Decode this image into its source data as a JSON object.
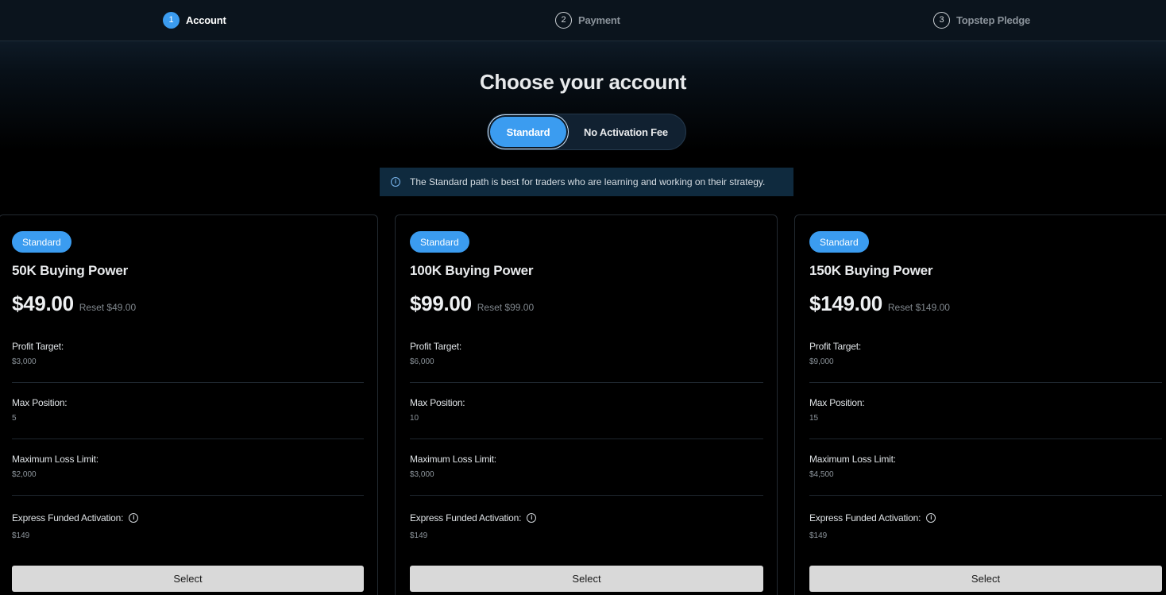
{
  "stepper": {
    "steps": [
      {
        "number": "1",
        "label": "Account",
        "state": "active"
      },
      {
        "number": "2",
        "label": "Payment",
        "state": "inactive"
      },
      {
        "number": "3",
        "label": "Topstep Pledge",
        "state": "inactive"
      }
    ]
  },
  "main": {
    "title": "Choose your account",
    "toggle": {
      "options": [
        "Standard",
        "No Activation Fee"
      ],
      "selected": "Standard"
    },
    "info": {
      "icon": "info-icon",
      "text": "The Standard path is best for traders who are learning and working on their strategy."
    }
  },
  "cards": [
    {
      "badge": "Standard",
      "title": "50K Buying Power",
      "price": "$49.00",
      "reset": "Reset $49.00",
      "fields": [
        {
          "label": "Profit Target:",
          "value": "$3,000"
        },
        {
          "label": "Max Position:",
          "value": "5"
        },
        {
          "label": "Maximum Loss Limit:",
          "value": "$2,000"
        },
        {
          "label": "Express Funded Activation:",
          "value": "$149"
        }
      ],
      "button": "Select"
    },
    {
      "badge": "Standard",
      "title": "100K Buying Power",
      "price": "$99.00",
      "reset": "Reset $99.00",
      "fields": [
        {
          "label": "Profit Target:",
          "value": "$6,000"
        },
        {
          "label": "Max Position:",
          "value": "10"
        },
        {
          "label": "Maximum Loss Limit:",
          "value": "$3,000"
        },
        {
          "label": "Express Funded Activation:",
          "value": "$149"
        }
      ],
      "button": "Select"
    },
    {
      "badge": "Standard",
      "title": "150K Buying Power",
      "price": "$149.00",
      "reset": "Reset $149.00",
      "fields": [
        {
          "label": "Profit Target:",
          "value": "$9,000"
        },
        {
          "label": "Max Position:",
          "value": "15"
        },
        {
          "label": "Maximum Loss Limit:",
          "value": "$4,500"
        },
        {
          "label": "Express Funded Activation:",
          "value": "$149"
        }
      ],
      "button": "Select"
    }
  ],
  "colors": {
    "accent": "#3b9cf0",
    "background": "#000000",
    "info_banner": "#0f2a3e",
    "select_button": "#d9d9d9"
  }
}
